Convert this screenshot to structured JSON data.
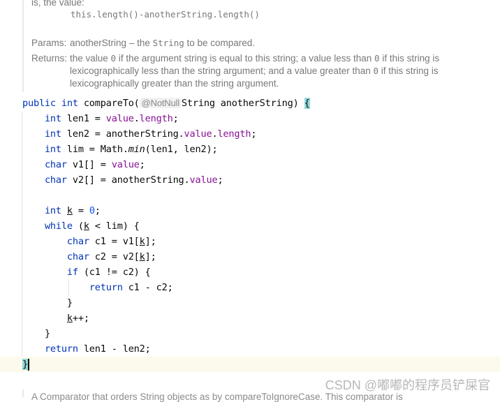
{
  "doc_top": {
    "line1": "is, the value:",
    "code": "this.length()-anotherString.length()",
    "params_label": "Params:",
    "params_name": "anotherString",
    "params_text_before": " – the ",
    "params_code": "String",
    "params_text_after": " to be compared.",
    "returns_label": "Returns:",
    "returns_l1a": "the value ",
    "zero": "0",
    "returns_l1b": " if the argument string is equal to this string; a value less than ",
    "returns_l1c": " if this string is",
    "returns_l2a": "lexicographically less than the string argument; and a value greater than ",
    "returns_l2b": " if this string is",
    "returns_l3": "lexicographically greater than the string argument."
  },
  "code": {
    "public": "public",
    "int": "int",
    "char": "char",
    "while": "while",
    "if": "if",
    "return": "return",
    "method_sig": " compareTo(",
    "annotation": "@NotNull",
    "sig_rest": "String anotherString) ",
    "open_brace": "{",
    "close_brace": "}",
    "l1a": " len1 = ",
    "value": "value",
    "length": "length",
    "semi": ";",
    "dot": ".",
    "l2a": " len2 = anotherString.",
    "l3a": " lim = Math.",
    "min": "min",
    "l3b": "(len1, len2);",
    "l4a": " v1[] = ",
    "l5a": " v2[] = anotherString.",
    "l6a": " ",
    "k": "k",
    "l6b": " = ",
    "zero": "0",
    "l7a": " (",
    "l7b": " < lim) {",
    "l8a": " c1 = v1[",
    "l8b": "];",
    "l9a": " c2 = v2[",
    "l10b": " (c1 != c2) {",
    "l11b": " c1 - c2;",
    "l13b": "++;",
    "l15b": " len1 - len2;"
  },
  "doc_bottom": "A Comparator that orders String objects as by compareToIgnoreCase. This comparator is",
  "watermark": "CSDN @嘟嘟的程序员铲屎官"
}
